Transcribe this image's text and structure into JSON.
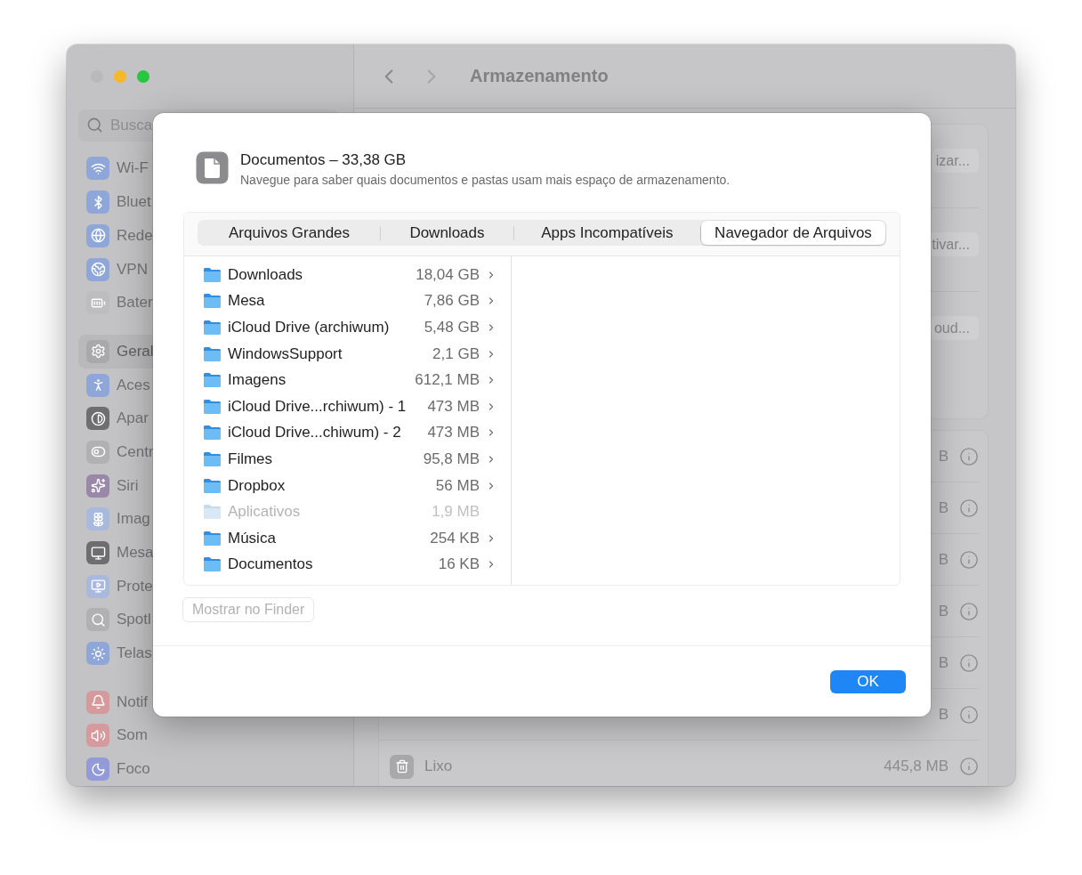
{
  "window": {
    "title": "Armazenamento"
  },
  "sidebar": {
    "search": {
      "placeholder": "Busca"
    },
    "groups": [
      {
        "items": [
          {
            "label": "Wi-F",
            "color": "#8ea6d8",
            "selected": false
          },
          {
            "label": "Bluet",
            "color": "#8ea6d8",
            "selected": false
          },
          {
            "label": "Rede",
            "color": "#8ea6d8",
            "selected": false
          },
          {
            "label": "VPN",
            "color": "#8ea6d8",
            "selected": false
          },
          {
            "label": "Bater",
            "color": "#bdbdbf",
            "selected": false
          }
        ]
      },
      {
        "items": [
          {
            "label": "Geral",
            "color": "#a9a9ab",
            "selected": true
          },
          {
            "label": "Aces",
            "color": "#8ea6d8",
            "selected": false
          },
          {
            "label": "Apar",
            "color": "#6e6e70",
            "selected": false
          },
          {
            "label": "Centr",
            "color": "#b1b1b3",
            "selected": false
          },
          {
            "label": "Siri",
            "color": "#9a88a8",
            "selected": false
          },
          {
            "label": "Imag",
            "color": "#a9b9de",
            "selected": false
          },
          {
            "label": "Mesa",
            "color": "#6e6e70",
            "selected": false
          },
          {
            "label": "Prote",
            "color": "#a9b9de",
            "selected": false
          },
          {
            "label": "Spotl",
            "color": "#b1b1b3",
            "selected": false
          },
          {
            "label": "Telas",
            "color": "#8ea6d8",
            "selected": false
          }
        ]
      },
      {
        "items": [
          {
            "label": "Notif",
            "color": "#d69a9c",
            "selected": false
          },
          {
            "label": "Som",
            "color": "#d69a9c",
            "selected": false
          },
          {
            "label": "Foco",
            "color": "#929ad8",
            "selected": false
          }
        ]
      }
    ]
  },
  "content": {
    "recommendations": [
      {
        "button": "izar..."
      },
      {
        "button": "tivar..."
      },
      {
        "button": "oud..."
      }
    ],
    "rows": [
      {
        "size": "B"
      },
      {
        "size": "B"
      },
      {
        "size": "B"
      },
      {
        "size": "B"
      },
      {
        "size": "B"
      },
      {
        "size": "B"
      },
      {
        "name": "Lixo",
        "size": "445,8 MB"
      }
    ]
  },
  "dialog": {
    "title": "Documentos – 33,38 GB",
    "subtitle": "Navegue para saber quais documentos e pastas usam mais espaço de armazenamento.",
    "tabs": [
      {
        "label": "Arquivos Grandes",
        "selected": false
      },
      {
        "label": "Downloads",
        "selected": false
      },
      {
        "label": "Apps Incompatíveis",
        "selected": false
      },
      {
        "label": "Navegador de Arquivos",
        "selected": true
      }
    ],
    "items": [
      {
        "name": "Downloads",
        "size": "18,04 GB",
        "disabled": false
      },
      {
        "name": "Mesa",
        "size": "7,86 GB",
        "disabled": false
      },
      {
        "name": "iCloud Drive (archiwum)",
        "size": "5,48 GB",
        "disabled": false
      },
      {
        "name": "WindowsSupport",
        "size": "2,1 GB",
        "disabled": false
      },
      {
        "name": "Imagens",
        "size": "612,1 MB",
        "disabled": false
      },
      {
        "name": "iCloud Drive...rchiwum) - 1",
        "size": "473 MB",
        "disabled": false
      },
      {
        "name": "iCloud Drive...chiwum) - 2",
        "size": "473 MB",
        "disabled": false
      },
      {
        "name": "Filmes",
        "size": "95,8 MB",
        "disabled": false
      },
      {
        "name": "Dropbox",
        "size": "56 MB",
        "disabled": false
      },
      {
        "name": "Aplicativos",
        "size": "1,9 MB",
        "disabled": true
      },
      {
        "name": "Música",
        "size": "254 KB",
        "disabled": false
      },
      {
        "name": "Documentos",
        "size": "16 KB",
        "disabled": false
      }
    ],
    "show_button": {
      "label": "Mostrar no Finder",
      "disabled": true
    },
    "ok_button": {
      "label": "OK"
    }
  }
}
